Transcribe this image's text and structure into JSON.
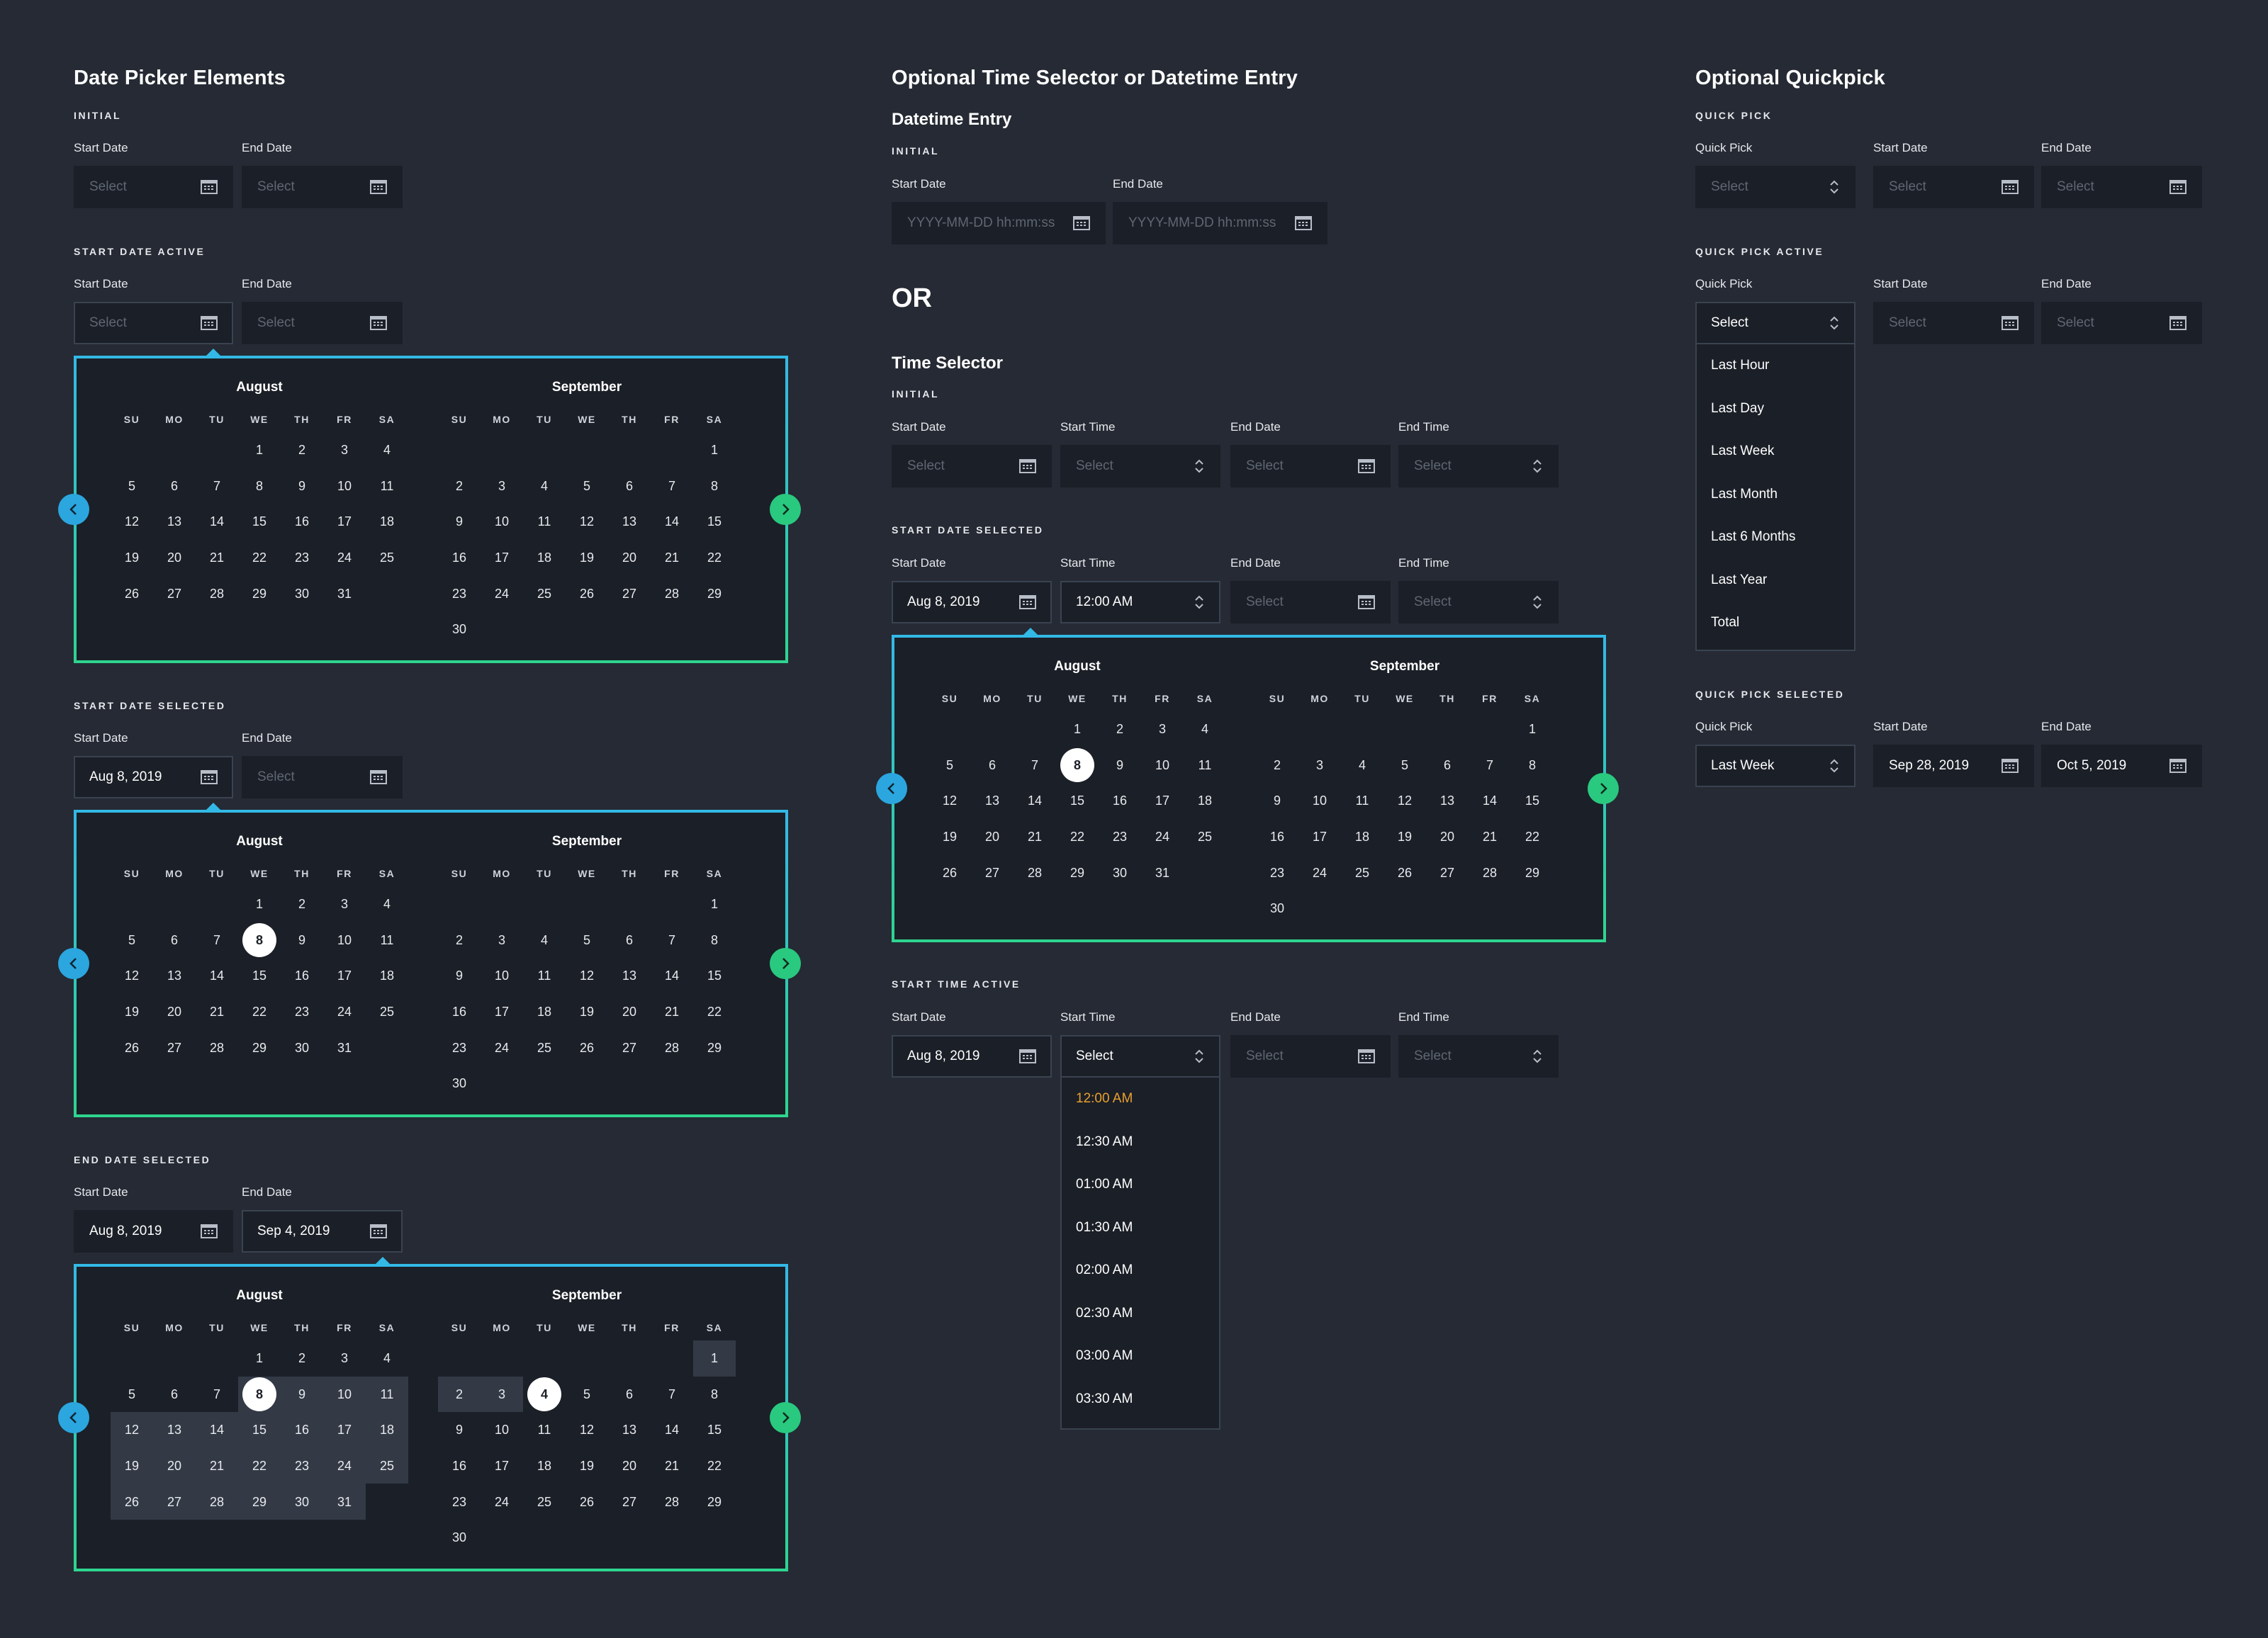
{
  "section1": {
    "title": "Date Picker Elements",
    "initial": {
      "caption": "INITIAL",
      "start_label": "Start Date",
      "end_label": "End Date",
      "start_value": "Select",
      "end_value": "Select"
    },
    "start_active": {
      "caption": "START DATE ACTIVE",
      "start_label": "Start Date",
      "end_label": "End Date",
      "start_value": "Select",
      "end_value": "Select"
    },
    "start_selected": {
      "caption": "START DATE SELECTED",
      "start_label": "Start Date",
      "end_label": "End Date",
      "start_value": "Aug 8, 2019",
      "end_value": "Select"
    },
    "end_selected": {
      "caption": "END DATE SELECTED",
      "start_label": "Start Date",
      "end_label": "End Date",
      "start_value": "Aug 8, 2019",
      "end_value": "Sep 4, 2019"
    }
  },
  "section2": {
    "title": "Optional Time Selector or Datetime Entry",
    "datetime_title": "Datetime Entry",
    "datetime_initial": {
      "caption": "INITIAL",
      "start_label": "Start Date",
      "end_label": "End Date",
      "start_placeholder": "YYYY-MM-DD hh:mm:ss",
      "end_placeholder": "YYYY-MM-DD hh:mm:ss"
    },
    "or_text": "OR",
    "time_title": "Time Selector",
    "time_initial": {
      "caption": "INITIAL",
      "start_date_label": "Start Date",
      "start_time_label": "Start Time",
      "end_date_label": "End Date",
      "end_time_label": "End Time",
      "start_date": "Select",
      "start_time": "Select",
      "end_date": "Select",
      "end_time": "Select"
    },
    "time_start_selected": {
      "caption": "START DATE SELECTED",
      "start_date_label": "Start Date",
      "start_time_label": "Start Time",
      "end_date_label": "End Date",
      "end_time_label": "End Time",
      "start_date": "Aug 8, 2019",
      "start_time": "12:00 AM",
      "end_date": "Select",
      "end_time": "Select"
    },
    "time_active": {
      "caption": "START TIME ACTIVE",
      "start_date_label": "Start Date",
      "start_time_label": "Start Time",
      "end_date_label": "End Date",
      "end_time_label": "End Time",
      "start_date": "Aug 8, 2019",
      "start_time": "Select",
      "end_date": "Select",
      "end_time": "Select",
      "options": [
        "12:00 AM",
        "12:30 AM",
        "01:00 AM",
        "01:30 AM",
        "02:00 AM",
        "02:30 AM",
        "03:00 AM",
        "03:30 AM"
      ],
      "highlighted_option": "12:00 AM"
    }
  },
  "section3": {
    "title": "Optional Quickpick",
    "quick": {
      "caption": "QUICK PICK",
      "quick_label": "Quick Pick",
      "start_label": "Start Date",
      "end_label": "End Date",
      "quick_value": "Select",
      "start_value": "Select",
      "end_value": "Select"
    },
    "quick_active": {
      "caption": "QUICK PICK ACTIVE",
      "quick_label": "Quick Pick",
      "start_label": "Start Date",
      "end_label": "End Date",
      "quick_value": "Select",
      "start_value": "Select",
      "end_value": "Select",
      "options": [
        "Last Hour",
        "Last Day",
        "Last Week",
        "Last Month",
        "Last 6 Months",
        "Last Year",
        "Total"
      ]
    },
    "quick_selected": {
      "caption": "QUICK PICK SELECTED",
      "quick_label": "Quick Pick",
      "start_label": "Start Date",
      "end_label": "End Date",
      "quick_value": "Last Week",
      "start_value": "Sep 28, 2019",
      "end_value": "Oct 5, 2019"
    }
  },
  "calendar": {
    "weekdays": [
      "SU",
      "MO",
      "TU",
      "WE",
      "TH",
      "FR",
      "SA"
    ],
    "months": [
      {
        "name": "August",
        "days": [
          "",
          "",
          "",
          "1",
          "2",
          "3",
          "4",
          "5",
          "6",
          "7",
          "8",
          "9",
          "10",
          "11",
          "12",
          "13",
          "14",
          "15",
          "16",
          "17",
          "18",
          "19",
          "20",
          "21",
          "22",
          "23",
          "24",
          "25",
          "26",
          "27",
          "28",
          "29",
          "30",
          "31"
        ]
      },
      {
        "name": "September",
        "days": [
          "",
          "",
          "",
          "",
          "",
          "",
          "1",
          "2",
          "3",
          "4",
          "5",
          "6",
          "7",
          "8",
          "9",
          "10",
          "11",
          "12",
          "13",
          "14",
          "15",
          "16",
          "17",
          "18",
          "19",
          "20",
          "21",
          "22",
          "23",
          "24",
          "25",
          "26",
          "27",
          "28",
          "29",
          "30"
        ]
      }
    ]
  },
  "colors": {
    "background": "#252a34",
    "field": "#1b1f27",
    "accent_blue": "#2ba6df",
    "accent_green": "#29c97f",
    "highlight_orange": "#e8a02f",
    "range": "#333a46"
  }
}
